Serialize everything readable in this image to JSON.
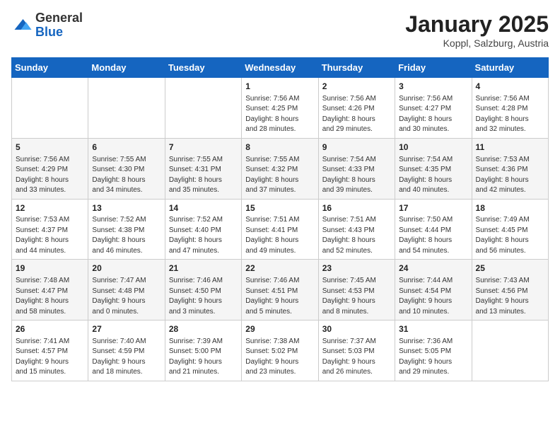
{
  "header": {
    "logo_general": "General",
    "logo_blue": "Blue",
    "month_title": "January 2025",
    "subtitle": "Koppl, Salzburg, Austria"
  },
  "weekdays": [
    "Sunday",
    "Monday",
    "Tuesday",
    "Wednesday",
    "Thursday",
    "Friday",
    "Saturday"
  ],
  "weeks": [
    [
      {
        "day": "",
        "info": ""
      },
      {
        "day": "",
        "info": ""
      },
      {
        "day": "",
        "info": ""
      },
      {
        "day": "1",
        "info": "Sunrise: 7:56 AM\nSunset: 4:25 PM\nDaylight: 8 hours\nand 28 minutes."
      },
      {
        "day": "2",
        "info": "Sunrise: 7:56 AM\nSunset: 4:26 PM\nDaylight: 8 hours\nand 29 minutes."
      },
      {
        "day": "3",
        "info": "Sunrise: 7:56 AM\nSunset: 4:27 PM\nDaylight: 8 hours\nand 30 minutes."
      },
      {
        "day": "4",
        "info": "Sunrise: 7:56 AM\nSunset: 4:28 PM\nDaylight: 8 hours\nand 32 minutes."
      }
    ],
    [
      {
        "day": "5",
        "info": "Sunrise: 7:56 AM\nSunset: 4:29 PM\nDaylight: 8 hours\nand 33 minutes."
      },
      {
        "day": "6",
        "info": "Sunrise: 7:55 AM\nSunset: 4:30 PM\nDaylight: 8 hours\nand 34 minutes."
      },
      {
        "day": "7",
        "info": "Sunrise: 7:55 AM\nSunset: 4:31 PM\nDaylight: 8 hours\nand 35 minutes."
      },
      {
        "day": "8",
        "info": "Sunrise: 7:55 AM\nSunset: 4:32 PM\nDaylight: 8 hours\nand 37 minutes."
      },
      {
        "day": "9",
        "info": "Sunrise: 7:54 AM\nSunset: 4:33 PM\nDaylight: 8 hours\nand 39 minutes."
      },
      {
        "day": "10",
        "info": "Sunrise: 7:54 AM\nSunset: 4:35 PM\nDaylight: 8 hours\nand 40 minutes."
      },
      {
        "day": "11",
        "info": "Sunrise: 7:53 AM\nSunset: 4:36 PM\nDaylight: 8 hours\nand 42 minutes."
      }
    ],
    [
      {
        "day": "12",
        "info": "Sunrise: 7:53 AM\nSunset: 4:37 PM\nDaylight: 8 hours\nand 44 minutes."
      },
      {
        "day": "13",
        "info": "Sunrise: 7:52 AM\nSunset: 4:38 PM\nDaylight: 8 hours\nand 46 minutes."
      },
      {
        "day": "14",
        "info": "Sunrise: 7:52 AM\nSunset: 4:40 PM\nDaylight: 8 hours\nand 47 minutes."
      },
      {
        "day": "15",
        "info": "Sunrise: 7:51 AM\nSunset: 4:41 PM\nDaylight: 8 hours\nand 49 minutes."
      },
      {
        "day": "16",
        "info": "Sunrise: 7:51 AM\nSunset: 4:43 PM\nDaylight: 8 hours\nand 52 minutes."
      },
      {
        "day": "17",
        "info": "Sunrise: 7:50 AM\nSunset: 4:44 PM\nDaylight: 8 hours\nand 54 minutes."
      },
      {
        "day": "18",
        "info": "Sunrise: 7:49 AM\nSunset: 4:45 PM\nDaylight: 8 hours\nand 56 minutes."
      }
    ],
    [
      {
        "day": "19",
        "info": "Sunrise: 7:48 AM\nSunset: 4:47 PM\nDaylight: 8 hours\nand 58 minutes."
      },
      {
        "day": "20",
        "info": "Sunrise: 7:47 AM\nSunset: 4:48 PM\nDaylight: 9 hours\nand 0 minutes."
      },
      {
        "day": "21",
        "info": "Sunrise: 7:46 AM\nSunset: 4:50 PM\nDaylight: 9 hours\nand 3 minutes."
      },
      {
        "day": "22",
        "info": "Sunrise: 7:46 AM\nSunset: 4:51 PM\nDaylight: 9 hours\nand 5 minutes."
      },
      {
        "day": "23",
        "info": "Sunrise: 7:45 AM\nSunset: 4:53 PM\nDaylight: 9 hours\nand 8 minutes."
      },
      {
        "day": "24",
        "info": "Sunrise: 7:44 AM\nSunset: 4:54 PM\nDaylight: 9 hours\nand 10 minutes."
      },
      {
        "day": "25",
        "info": "Sunrise: 7:43 AM\nSunset: 4:56 PM\nDaylight: 9 hours\nand 13 minutes."
      }
    ],
    [
      {
        "day": "26",
        "info": "Sunrise: 7:41 AM\nSunset: 4:57 PM\nDaylight: 9 hours\nand 15 minutes."
      },
      {
        "day": "27",
        "info": "Sunrise: 7:40 AM\nSunset: 4:59 PM\nDaylight: 9 hours\nand 18 minutes."
      },
      {
        "day": "28",
        "info": "Sunrise: 7:39 AM\nSunset: 5:00 PM\nDaylight: 9 hours\nand 21 minutes."
      },
      {
        "day": "29",
        "info": "Sunrise: 7:38 AM\nSunset: 5:02 PM\nDaylight: 9 hours\nand 23 minutes."
      },
      {
        "day": "30",
        "info": "Sunrise: 7:37 AM\nSunset: 5:03 PM\nDaylight: 9 hours\nand 26 minutes."
      },
      {
        "day": "31",
        "info": "Sunrise: 7:36 AM\nSunset: 5:05 PM\nDaylight: 9 hours\nand 29 minutes."
      },
      {
        "day": "",
        "info": ""
      }
    ]
  ]
}
